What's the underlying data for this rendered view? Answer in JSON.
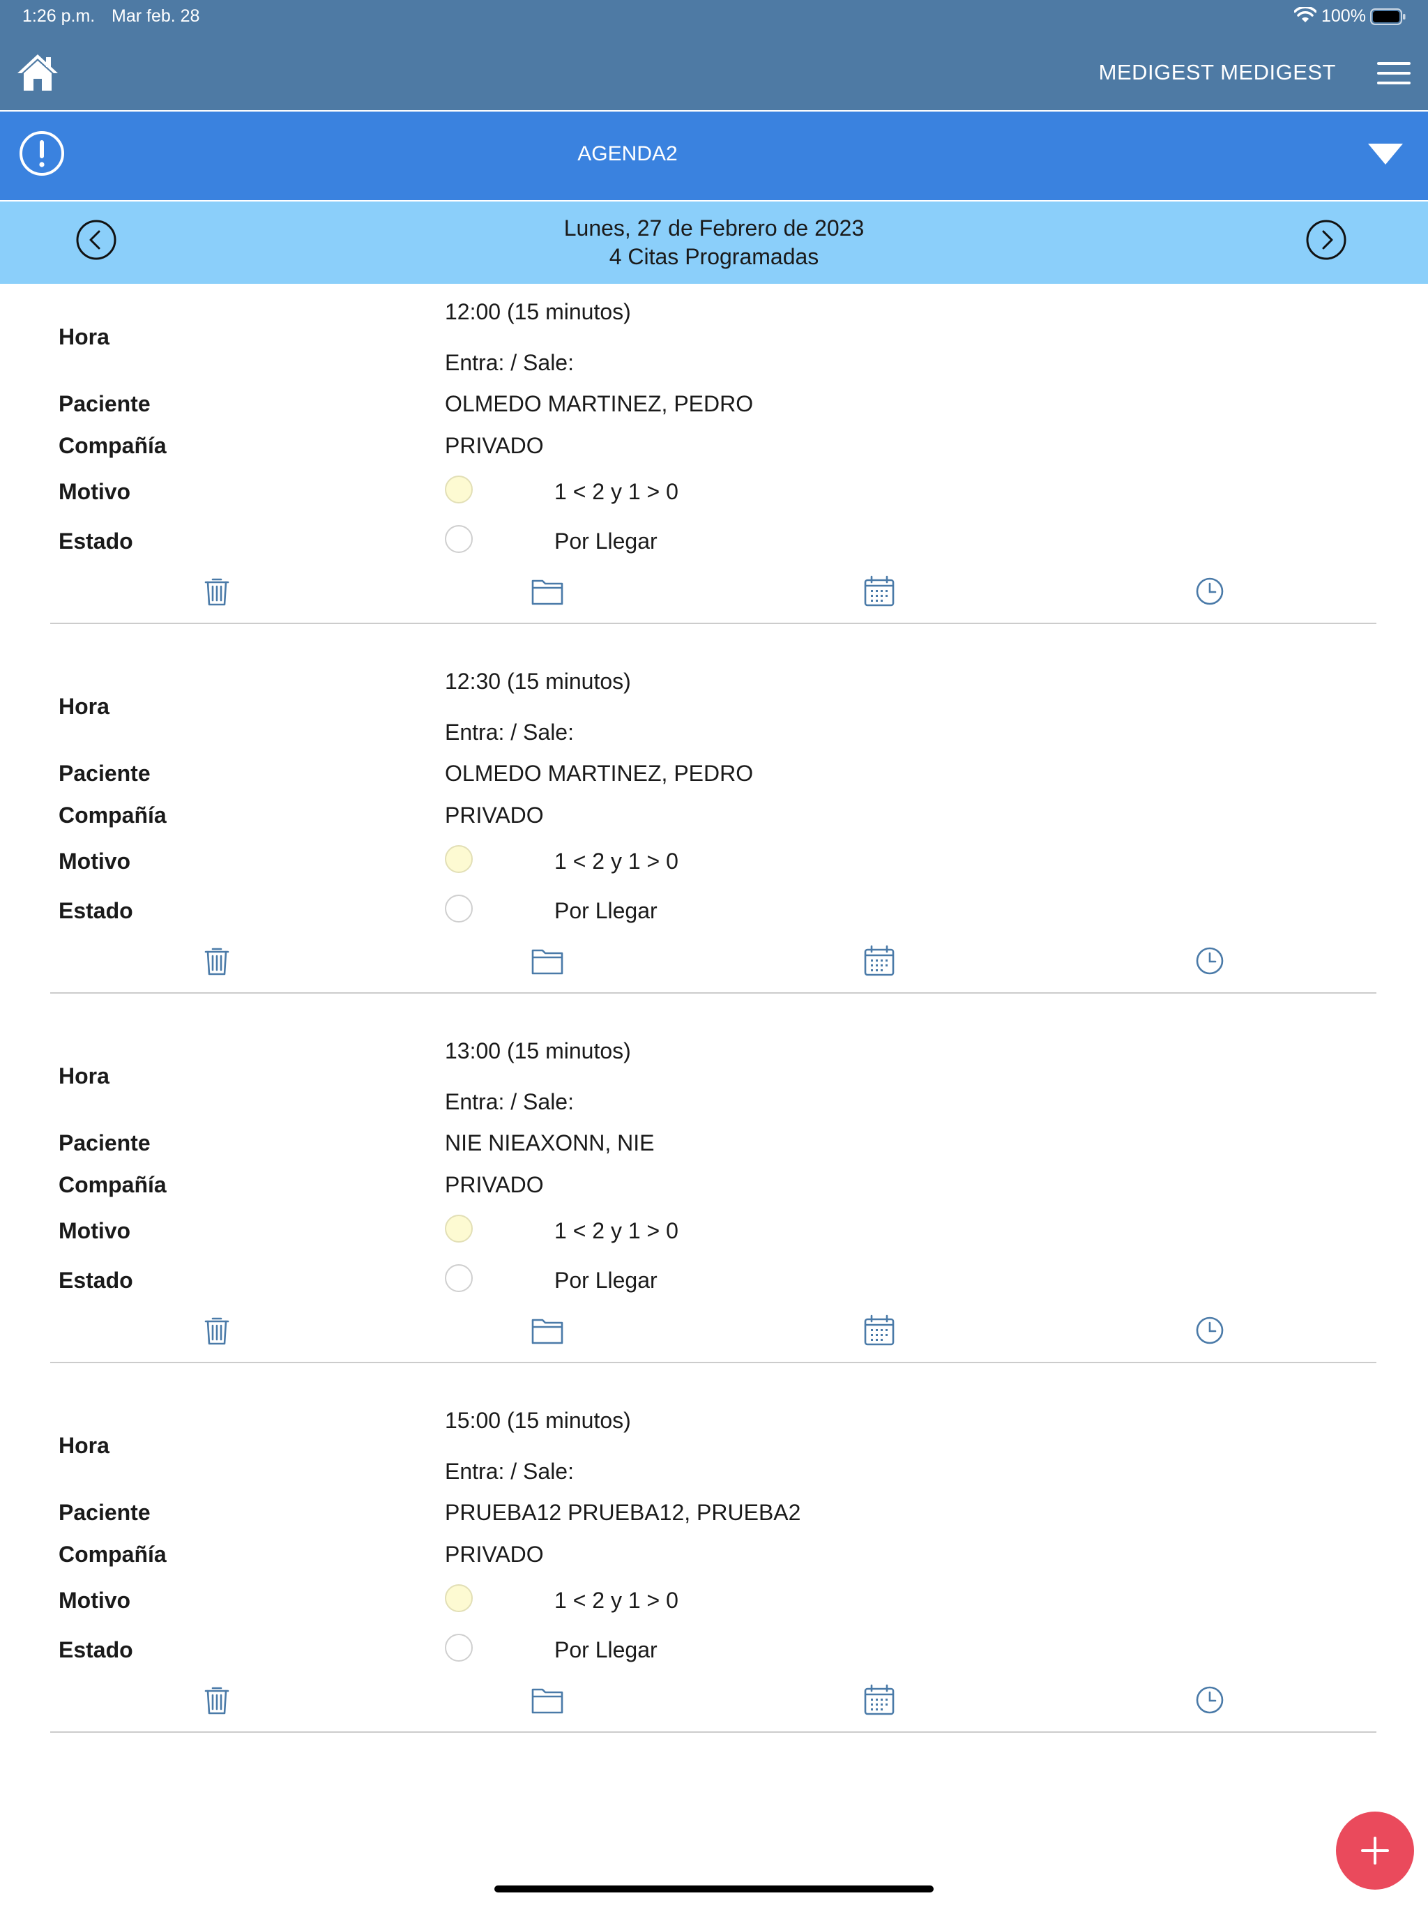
{
  "status_bar": {
    "time": "1:26 p.m.",
    "date": "Mar feb. 28",
    "battery": "100%"
  },
  "header": {
    "user": "MEDIGEST MEDIGEST"
  },
  "agenda": {
    "title": "AGENDA2"
  },
  "date_nav": {
    "date": "Lunes, 27 de Febrero de 2023",
    "count": "4 Citas Programadas"
  },
  "labels": {
    "hora": "Hora",
    "paciente": "Paciente",
    "compania": "Compañía",
    "motivo": "Motivo",
    "estado": "Estado"
  },
  "appointments": [
    {
      "time": "12:00 (15 minutos)",
      "entra_sale": "Entra: / Sale:",
      "patient": "OLMEDO MARTINEZ, PEDRO",
      "company": "PRIVADO",
      "motivo": "1 < 2 y 1 > 0",
      "estado": "Por Llegar"
    },
    {
      "time": "12:30 (15 minutos)",
      "entra_sale": "Entra: / Sale:",
      "patient": "OLMEDO MARTINEZ, PEDRO",
      "company": "PRIVADO",
      "motivo": "1 < 2 y 1 > 0",
      "estado": "Por Llegar"
    },
    {
      "time": "13:00 (15 minutos)",
      "entra_sale": "Entra: / Sale:",
      "patient": "NIE NIEAXONN, NIE",
      "company": "PRIVADO",
      "motivo": "1 < 2 y 1 > 0",
      "estado": "Por Llegar"
    },
    {
      "time": "15:00 (15 minutos)",
      "entra_sale": "Entra: / Sale:",
      "patient": "PRUEBA12 PRUEBA12, PRUEBA2",
      "company": "PRIVADO",
      "motivo": "1 < 2 y 1 > 0",
      "estado": "Por Llegar"
    }
  ],
  "colors": {
    "header": "#4e7aa4",
    "agenda_bar": "#3a82df",
    "date_bar": "#8bcffa",
    "action_icon": "#4a7aa8",
    "fab": "#ea4a5c",
    "motivo_dot": "#fdfad2"
  },
  "icons": {
    "home": "home-icon",
    "menu": "hamburger-menu-icon",
    "alert": "alert-circle-icon",
    "dropdown": "triangle-down-icon",
    "prev": "chevron-left-circle-icon",
    "next": "chevron-right-circle-icon",
    "delete": "trash-icon",
    "folder": "folder-icon",
    "calendar": "calendar-icon",
    "clock": "clock-icon",
    "add": "plus-icon"
  }
}
